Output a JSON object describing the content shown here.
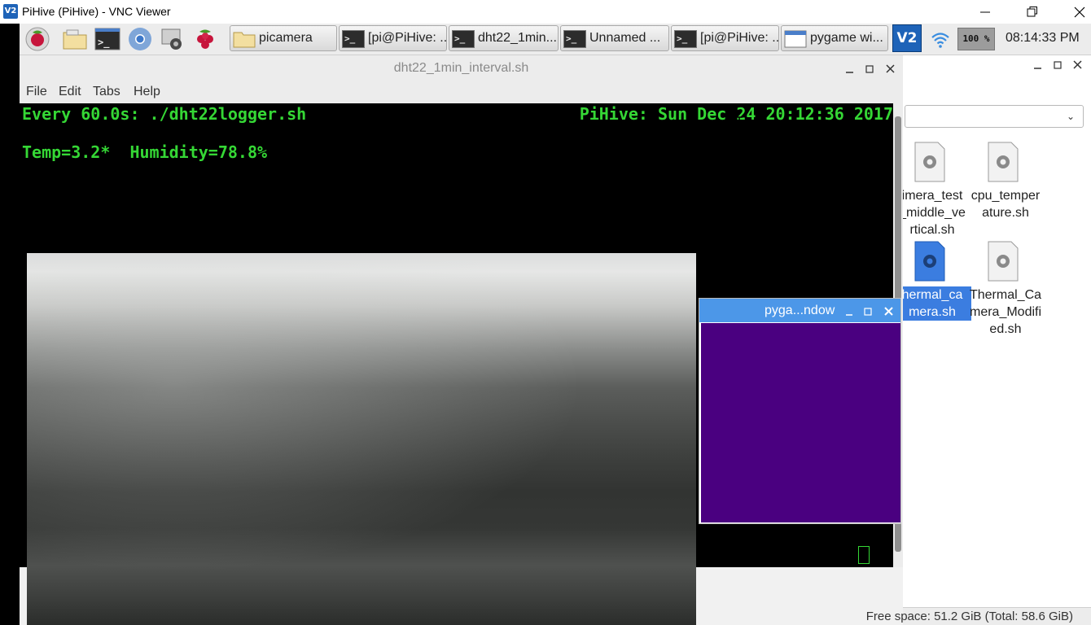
{
  "vnc": {
    "title": "PiHive (PiHive) - VNC Viewer",
    "logo_text": "V2"
  },
  "taskbar": {
    "launchers": [
      "raspberry-menu-icon",
      "file-manager-icon",
      "terminal-icon",
      "chromium-icon",
      "camera-app-icon",
      "raspberry-icon"
    ],
    "tasks": [
      {
        "label": "picamera",
        "icon": "folder-icon"
      },
      {
        "label": "[pi@PiHive: ...",
        "icon": "terminal-icon"
      },
      {
        "label": "dht22_1min...",
        "icon": "terminal-icon"
      },
      {
        "label": "Unnamed ...",
        "icon": "terminal-icon"
      },
      {
        "label": "[pi@PiHive: ...",
        "icon": "terminal-icon"
      },
      {
        "label": "pygame wi...",
        "icon": "window-icon"
      }
    ],
    "tray": {
      "vnc_text": "V2",
      "cpu": "100 %",
      "clock": "08:14:33 PM"
    }
  },
  "terminal": {
    "title": "dht22_1min_interval.sh",
    "menu": [
      "File",
      "Edit",
      "Tabs",
      "Help"
    ],
    "line1_left": "Every 60.0s: ./dht22logger.sh",
    "line1_right": "PiHive: Sun Dec 24 20:12:36 2017",
    "line2": "Temp=3.2*  Humidity=78.8%",
    "colors": {
      "text": "#35d735",
      "background": "#000000"
    }
  },
  "file_manager": {
    "items": [
      {
        "label": "imera_test\n_middle_ve\nrtical.sh",
        "selected": false,
        "icon": "script-gear-icon"
      },
      {
        "label": "cpu_temper\nature.sh",
        "selected": false,
        "icon": "script-gear-icon"
      },
      {
        "label": "hermal_ca\nmera.sh",
        "selected": true,
        "icon": "script-gear-icon"
      },
      {
        "label": "Thermal_Ca\nmera_Modifi\ned.sh",
        "selected": false,
        "icon": "script-gear-icon"
      }
    ],
    "free_space": "Free space: 51.2 GiB (Total: 58.6 GiB)"
  },
  "pygame": {
    "title": "pyga...ndow",
    "fill_color": "#4a0080"
  }
}
